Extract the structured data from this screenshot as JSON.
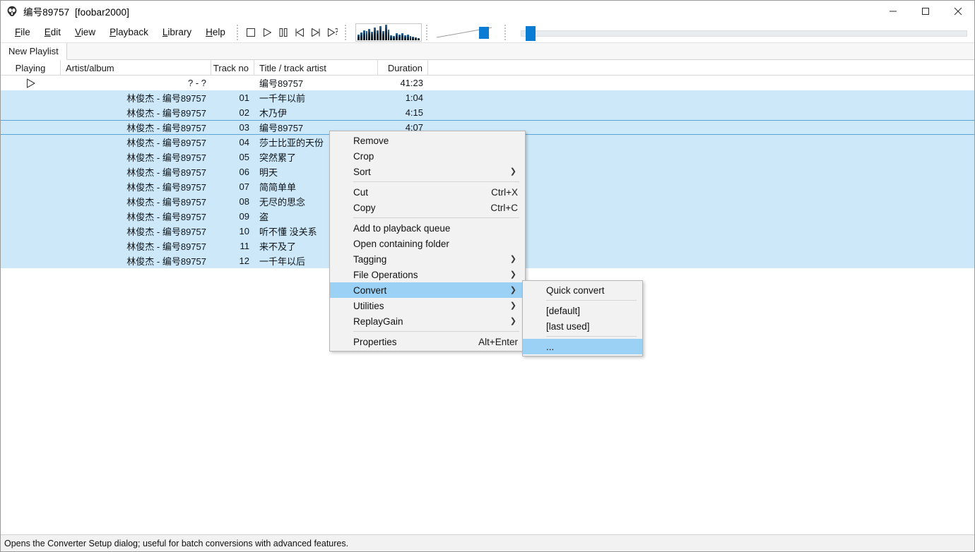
{
  "window": {
    "title": "编号89757  [foobar2000]",
    "icon": "foobar2000-skull-icon",
    "minimize_label": "–",
    "maximize_label": "□",
    "close_label": "✕"
  },
  "menubar": {
    "items": [
      {
        "name": "file",
        "label": "File",
        "mnemonic": "F"
      },
      {
        "name": "edit",
        "label": "Edit",
        "mnemonic": "E"
      },
      {
        "name": "view",
        "label": "View",
        "mnemonic": "V"
      },
      {
        "name": "playback",
        "label": "Playback",
        "mnemonic": "P"
      },
      {
        "name": "library",
        "label": "Library",
        "mnemonic": "L"
      },
      {
        "name": "help",
        "label": "Help",
        "mnemonic": "H"
      }
    ]
  },
  "transport": {
    "buttons": [
      {
        "name": "stop-button",
        "icon": "stop-icon"
      },
      {
        "name": "play-button",
        "icon": "play-icon"
      },
      {
        "name": "pause-button",
        "icon": "pause-icon"
      },
      {
        "name": "previous-button",
        "icon": "previous-icon"
      },
      {
        "name": "next-button",
        "icon": "next-icon"
      },
      {
        "name": "random-button",
        "icon": "random-icon"
      }
    ],
    "volume": {
      "name": "volume-slider",
      "value_pct": 76
    },
    "seek": {
      "name": "seek-slider",
      "value_pct": 1
    }
  },
  "visualizer": {
    "name": "spectrum-visualizer",
    "bar_heights_pct": [
      34,
      46,
      62,
      55,
      72,
      52,
      80,
      61,
      88,
      58,
      100,
      66,
      30,
      26,
      44,
      36,
      42,
      30,
      34,
      24,
      22,
      14,
      10
    ]
  },
  "playlist_tabs": {
    "tabs": [
      {
        "name": "tab-new-playlist",
        "label": "New Playlist",
        "active": true
      }
    ]
  },
  "playlist": {
    "columns": [
      {
        "key": "playing",
        "label": "Playing"
      },
      {
        "key": "artist",
        "label": "Artist/album"
      },
      {
        "key": "track",
        "label": "Track no"
      },
      {
        "key": "title",
        "label": "Title / track artist"
      },
      {
        "key": "duration",
        "label": "Duration"
      }
    ],
    "rows": [
      {
        "playing_icon": "play-triangle-icon",
        "artist": "? - ?",
        "track": "",
        "title": "编号89757",
        "duration": "41:23",
        "selected": false,
        "focused": false,
        "is_group": true
      },
      {
        "playing_icon": "",
        "artist": "林俊杰 - 编号89757",
        "track": "01",
        "title": "一千年以前",
        "duration": "1:04",
        "selected": true,
        "focused": false
      },
      {
        "playing_icon": "",
        "artist": "林俊杰 - 编号89757",
        "track": "02",
        "title": "木乃伊",
        "duration": "4:15",
        "selected": true,
        "focused": false
      },
      {
        "playing_icon": "",
        "artist": "林俊杰 - 编号89757",
        "track": "03",
        "title": "编号89757",
        "duration": "4:07",
        "selected": true,
        "focused": true
      },
      {
        "playing_icon": "",
        "artist": "林俊杰 - 编号89757",
        "track": "04",
        "title": "莎士比亚的天份",
        "duration": "",
        "selected": true,
        "focused": false
      },
      {
        "playing_icon": "",
        "artist": "林俊杰 - 编号89757",
        "track": "05",
        "title": "突然累了",
        "duration": "",
        "selected": true,
        "focused": false
      },
      {
        "playing_icon": "",
        "artist": "林俊杰 - 编号89757",
        "track": "06",
        "title": "明天",
        "duration": "",
        "selected": true,
        "focused": false
      },
      {
        "playing_icon": "",
        "artist": "林俊杰 - 编号89757",
        "track": "07",
        "title": "简简单单",
        "duration": "",
        "selected": true,
        "focused": false
      },
      {
        "playing_icon": "",
        "artist": "林俊杰 - 编号89757",
        "track": "08",
        "title": "无尽的思念",
        "duration": "",
        "selected": true,
        "focused": false
      },
      {
        "playing_icon": "",
        "artist": "林俊杰 - 编号89757",
        "track": "09",
        "title": "盗",
        "duration": "",
        "selected": true,
        "focused": false
      },
      {
        "playing_icon": "",
        "artist": "林俊杰 - 编号89757",
        "track": "10",
        "title": "听不懂 没关系",
        "duration": "",
        "selected": true,
        "focused": false
      },
      {
        "playing_icon": "",
        "artist": "林俊杰 - 编号89757",
        "track": "11",
        "title": "来不及了",
        "duration": "",
        "selected": true,
        "focused": false
      },
      {
        "playing_icon": "",
        "artist": "林俊杰 - 编号89757",
        "track": "12",
        "title": "一千年以后",
        "duration": "",
        "selected": true,
        "focused": false
      }
    ]
  },
  "context_menu": {
    "name": "playlist-context-menu",
    "items": [
      {
        "name": "remove",
        "label": "Remove",
        "accel": "",
        "submenu": false,
        "highlighted": false,
        "separator_after": false
      },
      {
        "name": "crop",
        "label": "Crop",
        "accel": "",
        "submenu": false,
        "highlighted": false,
        "separator_after": false
      },
      {
        "name": "sort",
        "label": "Sort",
        "accel": "",
        "submenu": true,
        "highlighted": false,
        "separator_after": true
      },
      {
        "name": "cut",
        "label": "Cut",
        "accel": "Ctrl+X",
        "submenu": false,
        "highlighted": false,
        "separator_after": false
      },
      {
        "name": "copy",
        "label": "Copy",
        "accel": "Ctrl+C",
        "submenu": false,
        "highlighted": false,
        "separator_after": true
      },
      {
        "name": "add-to-playback-queue",
        "label": "Add to playback queue",
        "accel": "",
        "submenu": false,
        "highlighted": false,
        "separator_after": false
      },
      {
        "name": "open-containing-folder",
        "label": "Open containing folder",
        "accel": "",
        "submenu": false,
        "highlighted": false,
        "separator_after": false
      },
      {
        "name": "tagging",
        "label": "Tagging",
        "accel": "",
        "submenu": true,
        "highlighted": false,
        "separator_after": false
      },
      {
        "name": "file-operations",
        "label": "File Operations",
        "accel": "",
        "submenu": true,
        "highlighted": false,
        "separator_after": false
      },
      {
        "name": "convert",
        "label": "Convert",
        "accel": "",
        "submenu": true,
        "highlighted": true,
        "separator_after": false
      },
      {
        "name": "utilities",
        "label": "Utilities",
        "accel": "",
        "submenu": true,
        "highlighted": false,
        "separator_after": false
      },
      {
        "name": "replaygain",
        "label": "ReplayGain",
        "accel": "",
        "submenu": true,
        "highlighted": false,
        "separator_after": true
      },
      {
        "name": "properties",
        "label": "Properties",
        "accel": "Alt+Enter",
        "submenu": false,
        "highlighted": false,
        "separator_after": false
      }
    ]
  },
  "convert_submenu": {
    "name": "convert-submenu",
    "items": [
      {
        "name": "quick-convert",
        "label": "Quick convert",
        "highlighted": false,
        "separator_after": true
      },
      {
        "name": "default-preset",
        "label": "[default]",
        "highlighted": false,
        "separator_after": false
      },
      {
        "name": "last-used-preset",
        "label": "[last used]",
        "highlighted": false,
        "separator_after": true
      },
      {
        "name": "converter-setup",
        "label": "...",
        "highlighted": true,
        "separator_after": false
      }
    ]
  },
  "statusbar": {
    "text": "Opens the Converter Setup dialog; useful for batch conversions with advanced features."
  },
  "colors": {
    "selection": "#cde8f8",
    "menu_highlight": "#9bd1f5",
    "accent": "#0b7cd4",
    "focus_border": "#5aa5d8"
  }
}
